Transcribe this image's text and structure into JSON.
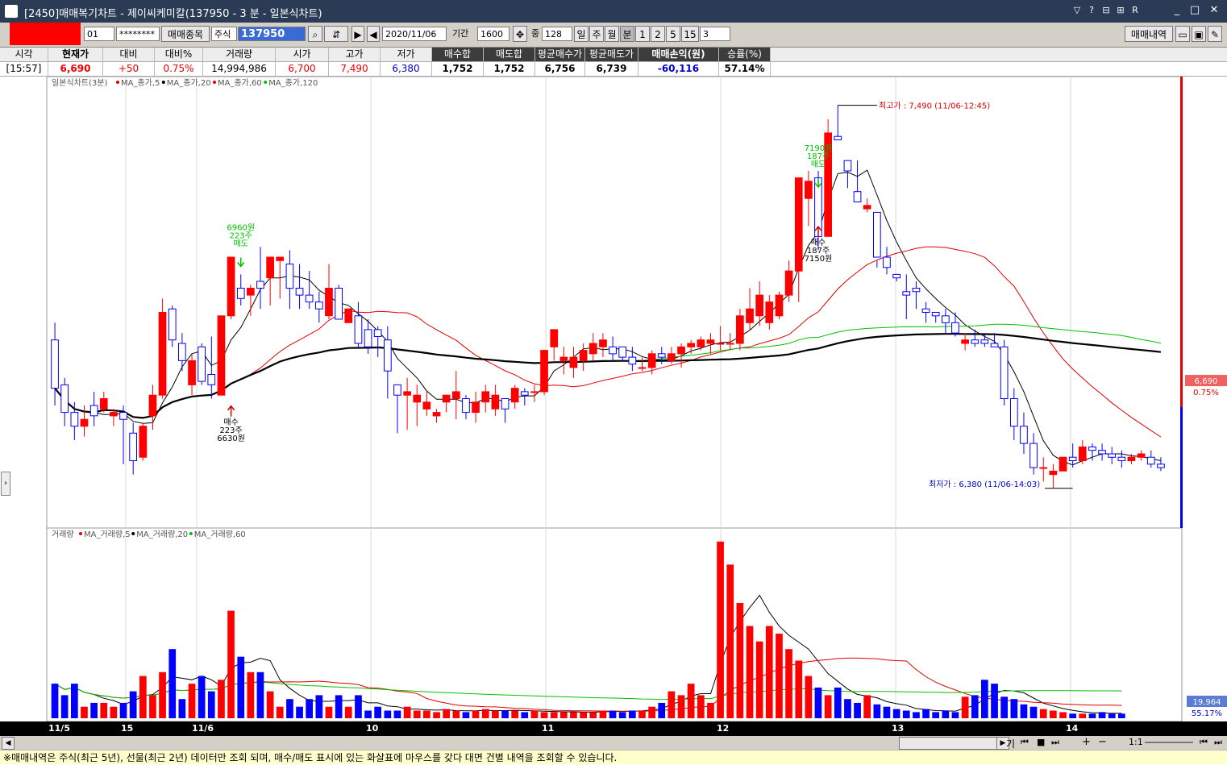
{
  "window": {
    "title": "[2450]매매복기차트 - 제이씨케미칼(137950 - 3 분 - 일본식차트)",
    "buttons": [
      "▽",
      "?",
      "⊟",
      "⊞",
      "R",
      "_",
      "□",
      "✕"
    ]
  },
  "toolbar": {
    "account_field": "01",
    "password_field": "********",
    "trade_item_button": "매매종목",
    "market_select": "주식",
    "code_input": "137950",
    "date_input": "2020/11/06",
    "period_label": "기간",
    "period_value": "1600",
    "overlap_label": "중",
    "overlap_value": "128",
    "period_tabs": [
      "일",
      "주",
      "월",
      "분",
      "1",
      "2",
      "5",
      "15"
    ],
    "interval_select": "3",
    "trade_history_button": "매매내역"
  },
  "info": {
    "headers": [
      "시각",
      "현재가",
      "대비",
      "대비%",
      "거래량",
      "시가",
      "고가",
      "저가",
      "매수합",
      "매도합",
      "평균매수가",
      "평균매도가",
      "매매손익(원)",
      "승률(%)"
    ],
    "values": [
      "[15:57]",
      "6,690",
      "+50",
      "0.75%",
      "14,994,986",
      "6,700",
      "7,490",
      "6,380",
      "1,752",
      "1,752",
      "6,756",
      "6,739",
      "-60,116",
      "57.14%"
    ]
  },
  "price_pane": {
    "legend_title": "일본식차트(3분)",
    "legend_items": [
      "MA_종가,5",
      "MA_종가,20",
      "MA_종가,60",
      "MA_종가,120"
    ],
    "high_annotation": "최고가 : 7,490 (11/06-12:45)",
    "low_annotation": "최저가 : 6,380 (11/06-14:03)",
    "current_price_tag": "6,690",
    "current_pct_tag": "0.75%",
    "trade_marks": [
      {
        "type": "매도",
        "price": "6960원",
        "qty": "223주",
        "action": "매도"
      },
      {
        "type": "매수",
        "price": "6630원",
        "qty": "223주",
        "action": "매수"
      },
      {
        "type": "매도",
        "price": "7190원",
        "qty": "187주",
        "action": "매도"
      },
      {
        "type": "매수",
        "price": "7150원",
        "qty": "187주",
        "action": "매수"
      }
    ]
  },
  "volume_pane": {
    "legend_title": "거래량",
    "legend_items": [
      "MA_거래량,5",
      "MA_거래량,20",
      "MA_거래량,60"
    ],
    "volume_tag": "19,964",
    "volume_pct_tag": "55.17%"
  },
  "xaxis": {
    "labels": [
      "11/5",
      "15",
      "11/6",
      "10",
      "11",
      "12",
      "13",
      "14"
    ]
  },
  "scroll": {
    "buttons": [
      "◀",
      "▶"
    ],
    "right_controls": [
      "기",
      "⏮",
      "■",
      "⏭",
      "+",
      "−",
      "1:1"
    ]
  },
  "status": {
    "message": "※매매내역은 주식(최근 5년), 선물(최근 2년) 데이터만 조회 되며, 매수/매도 표시에 있는 화살표에 마우스를 갖다 대면 건별 내역을 조회할 수 있습니다."
  },
  "colors": {
    "up": "#ff0000",
    "down": "#0000ff",
    "ma5": "#000000",
    "ma20": "#e00000",
    "ma60": "#00c000",
    "ma120": "#000000",
    "sell_mark": "#00c000",
    "buy_mark": "#000000"
  },
  "chart_data": {
    "type": "candlestick",
    "ylim": [
      6300,
      7550
    ],
    "candles": [
      [
        6810,
        6860,
        6620,
        6670
      ],
      [
        6680,
        6700,
        6560,
        6600
      ],
      [
        6600,
        6630,
        6520,
        6560
      ],
      [
        6560,
        6620,
        6530,
        6580
      ],
      [
        6620,
        6660,
        6560,
        6590
      ],
      [
        6610,
        6660,
        6600,
        6640
      ],
      [
        6590,
        6610,
        6560,
        6600
      ],
      [
        6600,
        6620,
        6450,
        6580
      ],
      [
        6540,
        6570,
        6420,
        6460
      ],
      [
        6470,
        6570,
        6460,
        6560
      ],
      [
        6590,
        6680,
        6550,
        6650
      ],
      [
        6650,
        6930,
        6640,
        6890
      ],
      [
        6900,
        6910,
        6790,
        6810
      ],
      [
        6800,
        6830,
        6720,
        6750
      ],
      [
        6680,
        6770,
        6650,
        6750
      ],
      [
        6790,
        6800,
        6680,
        6690
      ],
      [
        6710,
        6820,
        6640,
        6680
      ],
      [
        6650,
        6870,
        6650,
        6880
      ],
      [
        6880,
        7010,
        6870,
        7050
      ],
      [
        6960,
        7000,
        6910,
        6930
      ],
      [
        6940,
        6970,
        6880,
        6960
      ],
      [
        6980,
        7080,
        6900,
        6960
      ],
      [
        6990,
        7050,
        6910,
        7050
      ],
      [
        7040,
        7050,
        6930,
        7050
      ],
      [
        7030,
        7070,
        6900,
        6960
      ],
      [
        6960,
        7030,
        6900,
        6940
      ],
      [
        6940,
        7010,
        6900,
        6920
      ],
      [
        6920,
        6950,
        6860,
        6900
      ],
      [
        6880,
        7030,
        6870,
        6960
      ],
      [
        6960,
        6970,
        6870,
        6870
      ],
      [
        6860,
        6900,
        6860,
        6900
      ],
      [
        6880,
        6920,
        6790,
        6800
      ],
      [
        6840,
        6870,
        6770,
        6790
      ],
      [
        6840,
        6850,
        6760,
        6820
      ],
      [
        6810,
        6850,
        6640,
        6720
      ],
      [
        6680,
        6680,
        6540,
        6650
      ],
      [
        6650,
        6700,
        6550,
        6660
      ],
      [
        6630,
        6680,
        6560,
        6650
      ],
      [
        6610,
        6660,
        6590,
        6630
      ],
      [
        6590,
        6610,
        6570,
        6600
      ],
      [
        6630,
        6650,
        6600,
        6650
      ],
      [
        6640,
        6720,
        6580,
        6660
      ],
      [
        6640,
        6650,
        6580,
        6600
      ],
      [
        6600,
        6660,
        6570,
        6630
      ],
      [
        6630,
        6680,
        6600,
        6660
      ],
      [
        6610,
        6680,
        6590,
        6650
      ],
      [
        6640,
        6640,
        6570,
        6610
      ],
      [
        6630,
        6680,
        6610,
        6670
      ],
      [
        6660,
        6670,
        6620,
        6650
      ],
      [
        6660,
        6680,
        6630,
        6660
      ],
      [
        6660,
        6780,
        6650,
        6780
      ],
      [
        6790,
        6830,
        6750,
        6840
      ],
      [
        6750,
        6790,
        6710,
        6760
      ],
      [
        6730,
        6790,
        6700,
        6760
      ],
      [
        6750,
        6800,
        6720,
        6780
      ],
      [
        6770,
        6830,
        6750,
        6800
      ],
      [
        6790,
        6830,
        6760,
        6810
      ],
      [
        6790,
        6820,
        6750,
        6770
      ],
      [
        6790,
        6790,
        6750,
        6760
      ],
      [
        6760,
        6790,
        6720,
        6740
      ],
      [
        6730,
        6760,
        6720,
        6730
      ],
      [
        6730,
        6780,
        6710,
        6770
      ],
      [
        6770,
        6790,
        6740,
        6760
      ],
      [
        6750,
        6790,
        6740,
        6770
      ],
      [
        6770,
        6800,
        6730,
        6790
      ],
      [
        6790,
        6810,
        6770,
        6800
      ],
      [
        6790,
        6820,
        6780,
        6810
      ],
      [
        6800,
        6830,
        6770,
        6810
      ],
      [
        6800,
        6850,
        6780,
        6800
      ],
      [
        6800,
        6830,
        6780,
        6800
      ],
      [
        6800,
        6900,
        6780,
        6880
      ],
      [
        6860,
        6960,
        6840,
        6900
      ],
      [
        6880,
        6980,
        6850,
        6940
      ],
      [
        6860,
        6940,
        6840,
        6920
      ],
      [
        6880,
        6950,
        6870,
        6940
      ],
      [
        6940,
        7040,
        6920,
        7010
      ],
      [
        7010,
        7170,
        6920,
        7280
      ],
      [
        7220,
        7300,
        7140,
        7270
      ],
      [
        7280,
        7300,
        7070,
        7110
      ],
      [
        7110,
        7450,
        7170,
        7410
      ],
      [
        7400,
        7490,
        7400,
        7390
      ],
      [
        7330,
        7300,
        7250,
        7300
      ],
      [
        7240,
        7330,
        7210,
        7210
      ],
      [
        7190,
        7220,
        7180,
        7200
      ],
      [
        7180,
        7040,
        7020,
        7050
      ],
      [
        7050,
        7080,
        7000,
        7020
      ],
      [
        7000,
        7000,
        6980,
        6990
      ],
      [
        6950,
        7000,
        6870,
        6940
      ],
      [
        6960,
        6980,
        6900,
        6950
      ],
      [
        6900,
        6920,
        6860,
        6890
      ],
      [
        6890,
        6890,
        6860,
        6880
      ],
      [
        6880,
        6900,
        6830,
        6860
      ],
      [
        6860,
        6890,
        6820,
        6830
      ],
      [
        6800,
        6830,
        6780,
        6810
      ],
      [
        6810,
        6840,
        6790,
        6800
      ],
      [
        6810,
        6830,
        6790,
        6800
      ],
      [
        6800,
        6830,
        6790,
        6790
      ],
      [
        6790,
        6810,
        6620,
        6640
      ],
      [
        6640,
        6670,
        6520,
        6560
      ],
      [
        6560,
        6600,
        6480,
        6510
      ],
      [
        6510,
        6540,
        6420,
        6440
      ],
      [
        6440,
        6470,
        6400,
        6440
      ],
      [
        6420,
        6450,
        6380,
        6430
      ],
      [
        6430,
        6470,
        6430,
        6470
      ],
      [
        6470,
        6510,
        6440,
        6460
      ],
      [
        6460,
        6520,
        6450,
        6500
      ],
      [
        6500,
        6510,
        6460,
        6490
      ],
      [
        6490,
        6510,
        6460,
        6480
      ],
      [
        6480,
        6500,
        6450,
        6470
      ],
      [
        6470,
        6490,
        6440,
        6460
      ],
      [
        6460,
        6480,
        6450,
        6470
      ],
      [
        6470,
        6490,
        6460,
        6480
      ],
      [
        6470,
        6490,
        6440,
        6450
      ],
      [
        6450,
        6470,
        6430,
        6440
      ]
    ],
    "volumes": [
      45,
      30,
      45,
      15,
      20,
      20,
      15,
      20,
      35,
      55,
      30,
      60,
      90,
      25,
      45,
      55,
      35,
      50,
      140,
      80,
      60,
      60,
      35,
      15,
      25,
      15,
      25,
      30,
      15,
      30,
      15,
      30,
      10,
      15,
      10,
      10,
      15,
      10,
      10,
      8,
      12,
      10,
      8,
      10,
      12,
      10,
      10,
      10,
      8,
      10,
      8,
      8,
      8,
      8,
      8,
      8,
      10,
      10,
      8,
      10,
      10,
      15,
      20,
      35,
      30,
      45,
      30,
      20,
      230,
      200,
      150,
      120,
      100,
      120,
      110,
      90,
      75,
      55,
      40,
      30,
      40,
      25,
      20,
      30,
      18,
      15,
      12,
      10,
      8,
      12,
      8,
      10,
      8,
      28,
      30,
      50,
      45,
      28,
      25,
      18,
      15,
      12,
      10,
      8,
      6,
      6,
      6,
      8,
      6,
      6
    ]
  }
}
